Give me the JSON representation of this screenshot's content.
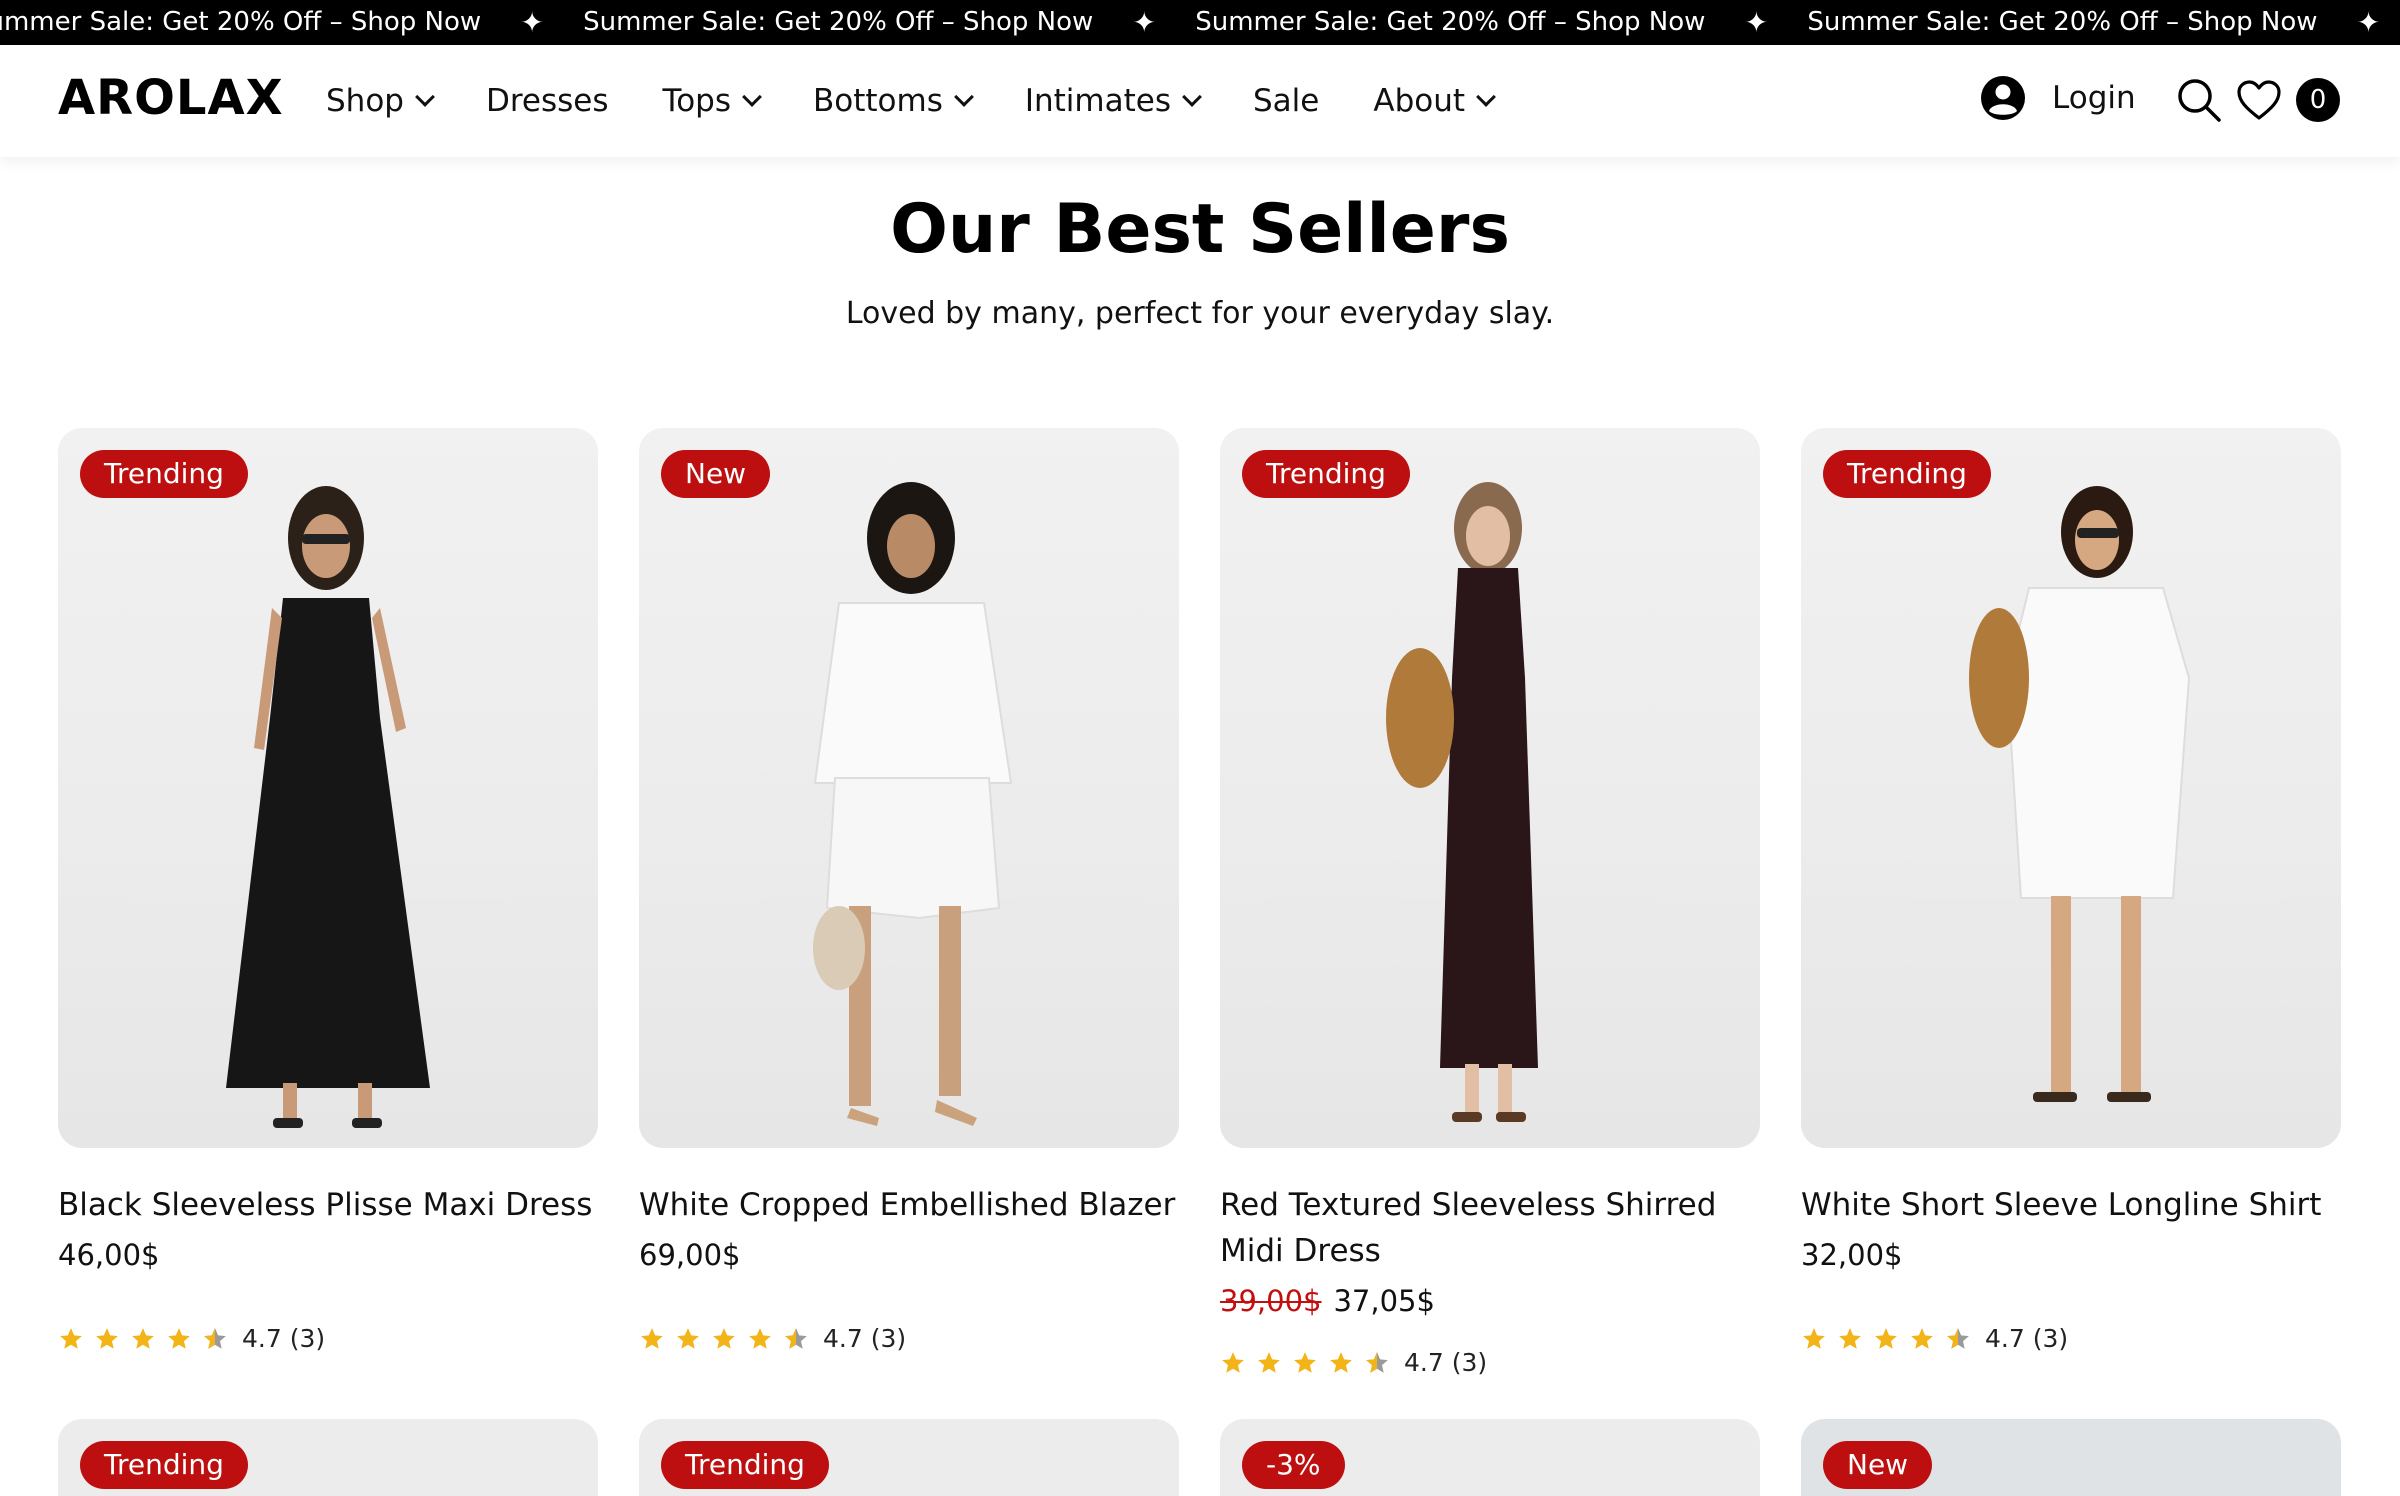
{
  "announcement": {
    "messages": [
      "Summer Sale: Get 20% Off – Shop Now",
      "Summer Sale: Get 20% Off – Shop Now",
      "Summer Sale: Get 20% Off – Shop Now",
      "Summer Sale: Get 20% Off – Shop Now"
    ],
    "separator": "✦"
  },
  "header": {
    "logo": "AROLAX",
    "nav": [
      {
        "label": "Shop"
      },
      {
        "label": "Dresses"
      },
      {
        "label": "Tops"
      },
      {
        "label": "Bottoms"
      },
      {
        "label": "Intimates"
      },
      {
        "label": "Sale"
      },
      {
        "label": "About"
      }
    ],
    "login_label": "Login",
    "cart_count": "0"
  },
  "section": {
    "title": "Our Best Sellers",
    "subtitle": "Loved by many, perfect for your everyday slay."
  },
  "products": [
    {
      "badge": "Trending",
      "name": "Black Sleeveless Plisse Maxi Dress",
      "price": "46,00$",
      "old_price": "",
      "rating": "4.7 (3)"
    },
    {
      "badge": "New",
      "name": "White Cropped Embellished Blazer",
      "price": "69,00$",
      "old_price": "",
      "rating": "4.7 (3)"
    },
    {
      "badge": "Trending",
      "name": "Red Textured Sleeveless Shirred Midi Dress",
      "price": "37,05$",
      "old_price": "39,00$",
      "rating": "4.7 (3)"
    },
    {
      "badge": "Trending",
      "name": "White Short Sleeve Longline Shirt",
      "price": "32,00$",
      "old_price": "",
      "rating": "4.7 (3)"
    }
  ],
  "products_row2": [
    {
      "badge": "Trending"
    },
    {
      "badge": "Trending"
    },
    {
      "badge": "-3%"
    },
    {
      "badge": "New"
    }
  ],
  "colors": {
    "badge": "#bd0f0f",
    "star": "#f2b416",
    "announcement_bg": "#000000"
  },
  "icons": [
    "user-icon",
    "search-icon",
    "heart-icon",
    "cart-count-badge",
    "chevron-down-icon",
    "star-icon"
  ]
}
